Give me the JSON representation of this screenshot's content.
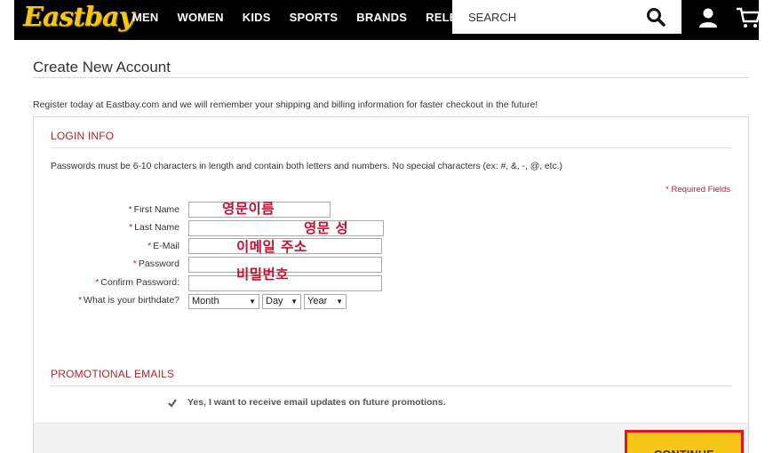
{
  "header": {
    "logo_text": "Eastbay",
    "nav": [
      "MEN",
      "WOMEN",
      "KIDS",
      "SPORTS",
      "BRANDS",
      "RELEASES"
    ],
    "search_placeholder": "SEARCH"
  },
  "page": {
    "title": "Create New Account",
    "intro": "Register today at Eastbay.com and we will remember your shipping and billing information for faster checkout in the future!"
  },
  "login": {
    "section_title": "LOGIN INFO",
    "password_note": "Passwords must be 6-10 characters in length and contain both letters and numbers. No special characters (ex: #, &, -, @, etc.)",
    "required_note": "* Required Fields",
    "required_star": "*",
    "fields": {
      "first_name": "First Name",
      "last_name": "Last Name",
      "email": "E-Mail",
      "password": "Password",
      "confirm_password": "Confirm Password:",
      "birthdate": "What is your birthdate?"
    },
    "birthdate_selects": {
      "month": "Month",
      "day": "Day",
      "year": "Year"
    }
  },
  "annotations": {
    "first_name": "영문이름",
    "last_name": "영문 성",
    "email": "이메일 주소",
    "password": "비밀번호"
  },
  "promo": {
    "section_title": "PROMOTIONAL EMAILS",
    "checkbox_label": "Yes, I want to receive email updates on future promotions.",
    "checked": true
  },
  "actions": {
    "continue_label": "CONTINUE"
  },
  "colors": {
    "brand_yellow": "#f5c518",
    "accent_red": "#b2242b",
    "highlight_red": "#e3141c",
    "annotation_red": "#c8102e"
  }
}
